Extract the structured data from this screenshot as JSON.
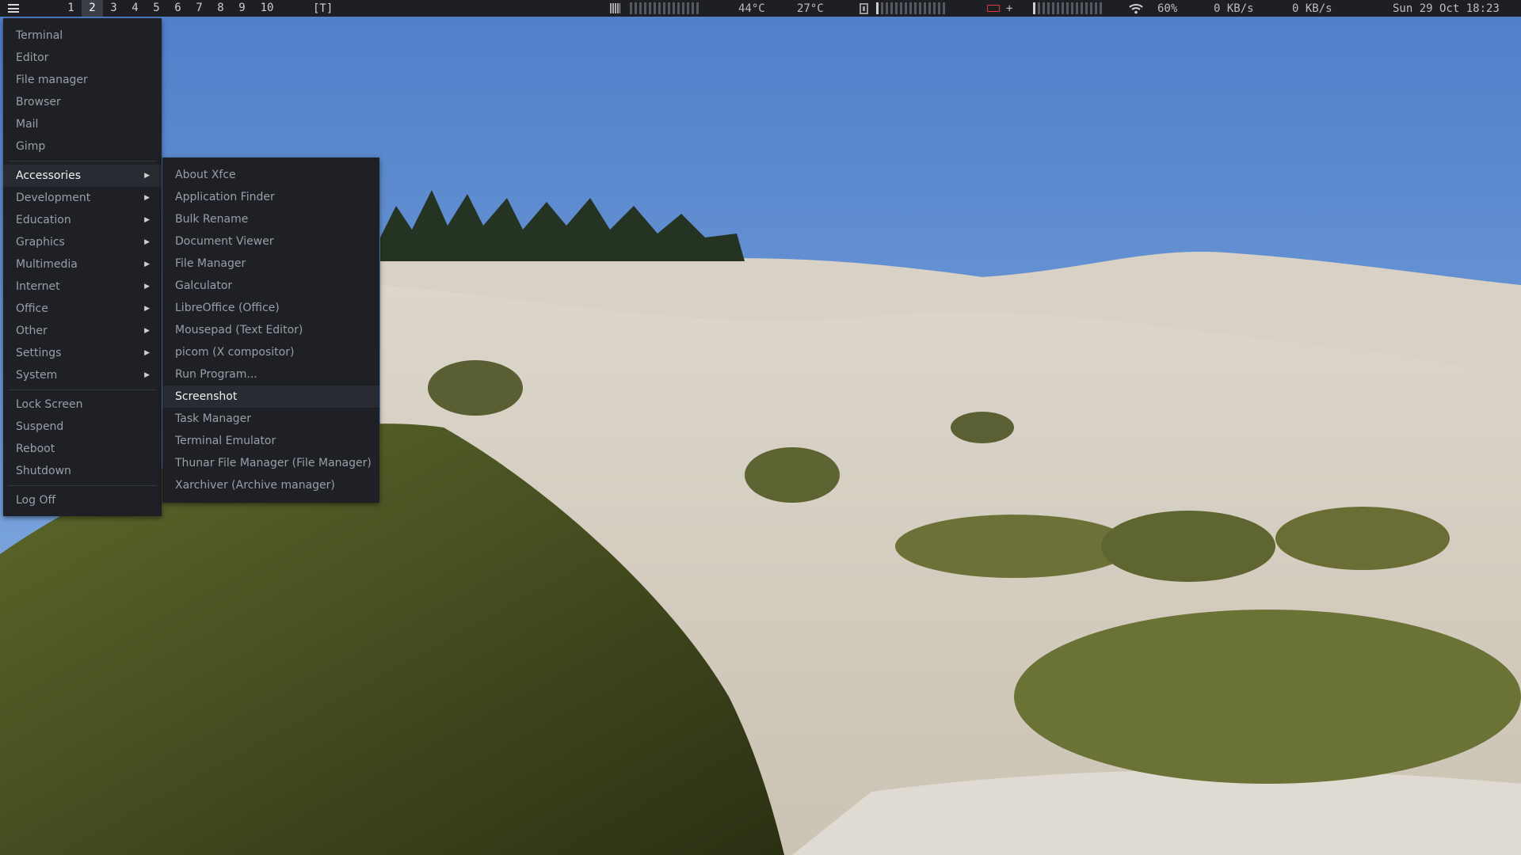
{
  "panel": {
    "menu_icon": "hamburger-icon",
    "workspaces": [
      "1",
      "2",
      "3",
      "4",
      "5",
      "6",
      "7",
      "8",
      "9",
      "10"
    ],
    "active_workspace": "2",
    "layout_indicator": "[T]",
    "cpu_temp": "44°C",
    "temp2": "27°C",
    "wifi_strength": "60%",
    "net_down": "0 KB/s",
    "net_up": "0 KB/s",
    "clock": "Sun 29 Oct 18:23",
    "battery_plus": "+",
    "colors": {
      "panel_bg": "#1e1f24",
      "battery": "#e0363c"
    }
  },
  "main_menu": {
    "apps": [
      "Terminal",
      "Editor",
      "File manager",
      "Browser",
      "Mail",
      "Gimp"
    ],
    "categories": [
      "Accessories",
      "Development",
      "Education",
      "Graphics",
      "Multimedia",
      "Internet",
      "Office",
      "Other",
      "Settings",
      "System"
    ],
    "active_category": "Accessories",
    "session": [
      "Lock Screen",
      "Suspend",
      "Reboot",
      "Shutdown"
    ],
    "logoff": "Log Off"
  },
  "sub_menu": {
    "items": [
      "About Xfce",
      "Application Finder",
      "Bulk Rename",
      "Document Viewer",
      "File Manager",
      "Galculator",
      "LibreOffice (Office)",
      "Mousepad (Text Editor)",
      "picom (X compositor)",
      "Run Program...",
      "Screenshot",
      "Task Manager",
      "Terminal Emulator",
      "Thunar File Manager (File Manager)",
      "Xarchiver (Archive manager)"
    ],
    "highlighted": "Screenshot"
  }
}
